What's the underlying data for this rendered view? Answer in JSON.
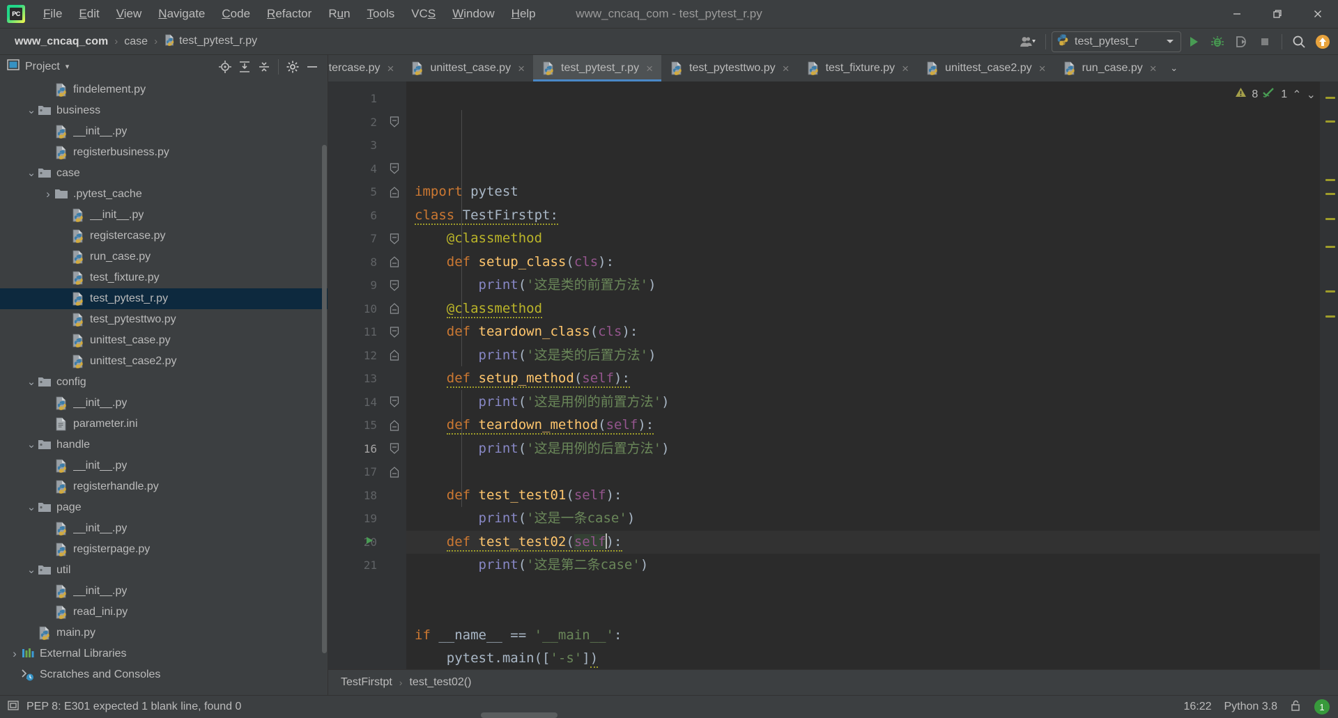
{
  "window": {
    "title": "www_cncaq_com - test_pytest_r.py",
    "logo_text": "PC",
    "minimize": "–",
    "restore": "restore-icon",
    "close": "×"
  },
  "menu": [
    {
      "label": "File",
      "mnemonic": "F"
    },
    {
      "label": "Edit",
      "mnemonic": "E"
    },
    {
      "label": "View",
      "mnemonic": "V"
    },
    {
      "label": "Navigate",
      "mnemonic": "N"
    },
    {
      "label": "Code",
      "mnemonic": "C"
    },
    {
      "label": "Refactor",
      "mnemonic": "R"
    },
    {
      "label": "Run",
      "mnemonic": "u"
    },
    {
      "label": "Tools",
      "mnemonic": "T"
    },
    {
      "label": "VCS",
      "mnemonic": "S"
    },
    {
      "label": "Window",
      "mnemonic": "W"
    },
    {
      "label": "Help",
      "mnemonic": "H"
    }
  ],
  "navbar": {
    "crumbs": [
      {
        "label": "www_cncaq_com",
        "strong": true
      },
      {
        "label": "case",
        "strong": false
      },
      {
        "label": "test_pytest_r.py",
        "strong": false,
        "icon": "python-file-icon"
      }
    ],
    "separator": "›",
    "run_config": {
      "label": "test_pytest_r",
      "icon": "python-icon",
      "dropdown": "▼"
    },
    "buttons": [
      {
        "name": "account-icon",
        "label": ""
      },
      {
        "name": "run-button",
        "label": ""
      },
      {
        "name": "debug-button",
        "label": ""
      },
      {
        "name": "coverage-button",
        "label": ""
      },
      {
        "name": "stop-button",
        "label": ""
      },
      {
        "name": "search-everywhere-button",
        "label": ""
      },
      {
        "name": "update-project-button",
        "label": ""
      }
    ]
  },
  "sidebar": {
    "title": "Project",
    "dropdown_caret": "▾",
    "header_buttons": [
      {
        "name": "locate-file-icon"
      },
      {
        "name": "expand-all-icon"
      },
      {
        "name": "collapse-all-icon"
      },
      {
        "name": "settings-gear-icon"
      },
      {
        "name": "hide-panel-icon"
      }
    ],
    "tree": [
      {
        "label": "findelement.py",
        "indent": 2,
        "type": "py",
        "twisty": "",
        "selected": false
      },
      {
        "label": "business",
        "indent": 1,
        "type": "folder",
        "twisty": "⌄",
        "selected": false
      },
      {
        "label": "__init__.py",
        "indent": 2,
        "type": "py",
        "twisty": "",
        "selected": false
      },
      {
        "label": "registerbusiness.py",
        "indent": 2,
        "type": "py",
        "twisty": "",
        "selected": false
      },
      {
        "label": "case",
        "indent": 1,
        "type": "folder",
        "twisty": "⌄",
        "selected": false
      },
      {
        "label": ".pytest_cache",
        "indent": 2,
        "type": "plainfolder",
        "twisty": "›",
        "selected": false
      },
      {
        "label": "__init__.py",
        "indent": 3,
        "type": "py",
        "twisty": "",
        "selected": false
      },
      {
        "label": "registercase.py",
        "indent": 3,
        "type": "py",
        "twisty": "",
        "selected": false
      },
      {
        "label": "run_case.py",
        "indent": 3,
        "type": "py",
        "twisty": "",
        "selected": false
      },
      {
        "label": "test_fixture.py",
        "indent": 3,
        "type": "py",
        "twisty": "",
        "selected": false
      },
      {
        "label": "test_pytest_r.py",
        "indent": 3,
        "type": "py",
        "twisty": "",
        "selected": true
      },
      {
        "label": "test_pytesttwo.py",
        "indent": 3,
        "type": "py",
        "twisty": "",
        "selected": false
      },
      {
        "label": "unittest_case.py",
        "indent": 3,
        "type": "py",
        "twisty": "",
        "selected": false
      },
      {
        "label": "unittest_case2.py",
        "indent": 3,
        "type": "py",
        "twisty": "",
        "selected": false
      },
      {
        "label": "config",
        "indent": 1,
        "type": "folder",
        "twisty": "⌄",
        "selected": false
      },
      {
        "label": "__init__.py",
        "indent": 2,
        "type": "py",
        "twisty": "",
        "selected": false
      },
      {
        "label": "parameter.ini",
        "indent": 2,
        "type": "ini",
        "twisty": "",
        "selected": false
      },
      {
        "label": "handle",
        "indent": 1,
        "type": "folder",
        "twisty": "⌄",
        "selected": false
      },
      {
        "label": "__init__.py",
        "indent": 2,
        "type": "py",
        "twisty": "",
        "selected": false
      },
      {
        "label": "registerhandle.py",
        "indent": 2,
        "type": "py",
        "twisty": "",
        "selected": false
      },
      {
        "label": "page",
        "indent": 1,
        "type": "folder",
        "twisty": "⌄",
        "selected": false
      },
      {
        "label": "__init__.py",
        "indent": 2,
        "type": "py",
        "twisty": "",
        "selected": false
      },
      {
        "label": "registerpage.py",
        "indent": 2,
        "type": "py",
        "twisty": "",
        "selected": false
      },
      {
        "label": "util",
        "indent": 1,
        "type": "folder",
        "twisty": "⌄",
        "selected": false
      },
      {
        "label": "__init__.py",
        "indent": 2,
        "type": "py",
        "twisty": "",
        "selected": false
      },
      {
        "label": "read_ini.py",
        "indent": 2,
        "type": "py",
        "twisty": "",
        "selected": false
      },
      {
        "label": "main.py",
        "indent": 1,
        "type": "py",
        "twisty": "",
        "selected": false
      },
      {
        "label": "External Libraries",
        "indent": 0,
        "type": "library",
        "twisty": "›",
        "selected": false
      },
      {
        "label": "Scratches and Consoles",
        "indent": 0,
        "type": "scratch",
        "twisty": "",
        "selected": false
      }
    ]
  },
  "tabs": [
    {
      "label": "registercase.py",
      "active": false,
      "truncated": true
    },
    {
      "label": "unittest_case.py",
      "active": false,
      "truncated": false
    },
    {
      "label": "test_pytest_r.py",
      "active": true,
      "truncated": false
    },
    {
      "label": "test_pytesttwo.py",
      "active": false,
      "truncated": false
    },
    {
      "label": "test_fixture.py",
      "active": false,
      "truncated": false
    },
    {
      "label": "unittest_case2.py",
      "active": false,
      "truncated": false
    },
    {
      "label": "run_case.py",
      "active": false,
      "truncated": false
    }
  ],
  "tab_close_glyph": "×",
  "tabs_overflow_glyph": "⌄",
  "inspection": {
    "warning_count": "8",
    "check_count": "1",
    "up_glyph": "⌃",
    "down_glyph": "⌄"
  },
  "editor": {
    "file": "test_pytest_r.py",
    "current_line": 16,
    "total_lines": 21,
    "lines": [
      {
        "n": 1,
        "fold": "",
        "run": false,
        "text": "import pytest"
      },
      {
        "n": 2,
        "fold": "open",
        "run": false,
        "text": "class TestFirstpt:"
      },
      {
        "n": 3,
        "fold": "",
        "run": false,
        "text": "    @classmethod"
      },
      {
        "n": 4,
        "fold": "open",
        "run": false,
        "text": "    def setup_class(cls):"
      },
      {
        "n": 5,
        "fold": "end",
        "run": false,
        "text": "        print('这是类的前置方法')"
      },
      {
        "n": 6,
        "fold": "",
        "run": false,
        "text": "    @classmethod"
      },
      {
        "n": 7,
        "fold": "open",
        "run": false,
        "text": "    def teardown_class(cls):"
      },
      {
        "n": 8,
        "fold": "end",
        "run": false,
        "text": "        print('这是类的后置方法')"
      },
      {
        "n": 9,
        "fold": "open",
        "run": false,
        "text": "    def setup_method(self):"
      },
      {
        "n": 10,
        "fold": "end",
        "run": false,
        "text": "        print('这是用例的前置方法')"
      },
      {
        "n": 11,
        "fold": "open",
        "run": false,
        "text": "    def teardown_method(self):"
      },
      {
        "n": 12,
        "fold": "end",
        "run": false,
        "text": "        print('这是用例的后置方法')"
      },
      {
        "n": 13,
        "fold": "",
        "run": false,
        "text": ""
      },
      {
        "n": 14,
        "fold": "open",
        "run": false,
        "text": "    def test_test01(self):"
      },
      {
        "n": 15,
        "fold": "end",
        "run": false,
        "text": "        print('这是一条case')"
      },
      {
        "n": 16,
        "fold": "open",
        "run": false,
        "text": "    def test_test02(self):"
      },
      {
        "n": 17,
        "fold": "end",
        "run": false,
        "text": "        print('这是第二条case')"
      },
      {
        "n": 18,
        "fold": "",
        "run": false,
        "text": ""
      },
      {
        "n": 19,
        "fold": "",
        "run": false,
        "text": ""
      },
      {
        "n": 20,
        "fold": "",
        "run": true,
        "text": "if __name__ == '__main__':"
      },
      {
        "n": 21,
        "fold": "",
        "run": false,
        "text": "    pytest.main(['-s'])"
      }
    ]
  },
  "breadcrumb": {
    "items": [
      "TestFirstpt",
      "test_test02()"
    ],
    "separator": "›"
  },
  "statusbar": {
    "message": "PEP 8: E301 expected 1 blank line, found 0",
    "time": "16:22",
    "interpreter": "Python 3.8",
    "notification_count": "1",
    "lock_icon": "unlocked-padlock-icon"
  },
  "colors": {
    "background": "#3c3f41",
    "editor_bg": "#2b2b2b",
    "gutter_bg": "#313335",
    "accent_blue": "#4a88c7",
    "selection_blue": "#0d293e",
    "keyword": "#cc7832",
    "string": "#6a8759",
    "function": "#ffc66d",
    "decorator": "#bbb529",
    "self_param": "#94558d",
    "builtin": "#8888c6",
    "text": "#a9b7c6",
    "run_green": "#499c54",
    "badge_green": "#389a3c",
    "update_orange": "#e8a33d"
  }
}
